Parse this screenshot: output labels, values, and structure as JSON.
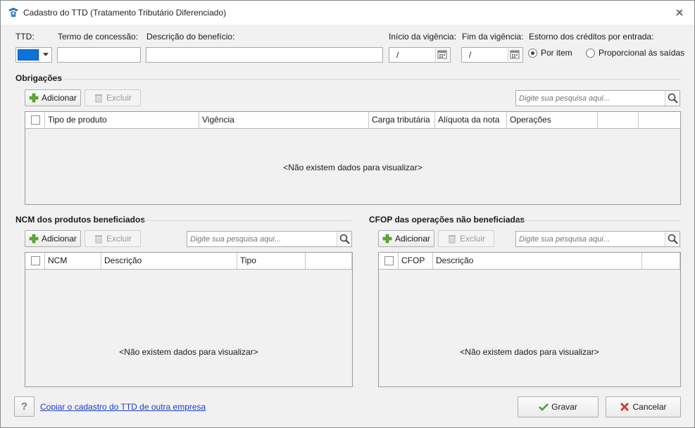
{
  "window": {
    "title": "Cadastro do TTD (Tratamento Tributário Diferenciado)"
  },
  "form": {
    "ttd_label": "TTD:",
    "termo_label": "Termo de concessão:",
    "termo_value": "",
    "descricao_label": "Descrição do benefício:",
    "descricao_value": "",
    "inicio_label": "Início da vigência:",
    "inicio_value": "/",
    "fim_label": "Fim da vigência:",
    "fim_value": "/",
    "estorno_label": "Estorno dos créditos por entrada:",
    "estorno_options": [
      {
        "label": "Por item",
        "selected": true
      },
      {
        "label": "Proporcional às saídas",
        "selected": false
      }
    ],
    "ttd_color": "#0a74d8"
  },
  "obrigacoes": {
    "title": "Obrigações",
    "add_label": "Adicionar",
    "delete_label": "Excluir",
    "search_placeholder": "Digite sua pesquisa aqui...",
    "columns": [
      "Tipo de produto",
      "Vigência",
      "Carga tributária",
      "Alíquota da nota",
      "Operações"
    ],
    "empty_text": "<Não existem dados para visualizar>"
  },
  "ncm": {
    "title": "NCM dos produtos beneficiados",
    "add_label": "Adicionar",
    "delete_label": "Excluir",
    "search_placeholder": "Digite sua pesquisa aqui...",
    "columns": [
      "NCM",
      "Descrição",
      "Tipo"
    ],
    "empty_text": "<Não existem dados para visualizar>"
  },
  "cfop": {
    "title": "CFOP das operações não beneficiadas",
    "add_label": "Adicionar",
    "delete_label": "Excluir",
    "search_placeholder": "Digite sua pesquisa aqui...",
    "columns": [
      "CFOP",
      "Descrição"
    ],
    "empty_text": "<Não existem dados para visualizar>"
  },
  "footer": {
    "help_label": "?",
    "copy_link": "Copiar o cadastro do TTD de outra empresa",
    "save_label": "Gravar",
    "cancel_label": "Cancelar"
  },
  "icons": [
    "app-icon",
    "close-icon",
    "chevron-down-icon",
    "calendar-icon",
    "plus-icon",
    "trash-icon",
    "search-icon",
    "check-icon",
    "x-icon"
  ]
}
